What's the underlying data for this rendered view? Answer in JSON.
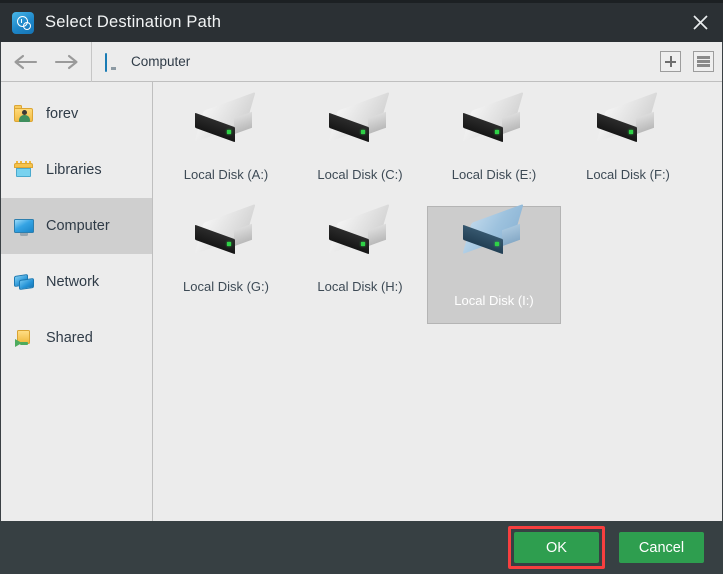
{
  "window": {
    "title": "Select Destination Path",
    "app_icon": "clock-gear-icon",
    "close_icon": "close-icon"
  },
  "toolbar": {
    "back_icon": "arrow-left-icon",
    "forward_icon": "arrow-right-icon",
    "breadcrumb_icon": "computer-monitor-icon",
    "breadcrumb_label": "Computer",
    "new_folder_icon": "plus-icon",
    "view_list_icon": "list-view-icon"
  },
  "sidebar": {
    "items": [
      {
        "label": "forev",
        "icon": "user-folder-icon",
        "selected": false
      },
      {
        "label": "Libraries",
        "icon": "libraries-folder-icon",
        "selected": false
      },
      {
        "label": "Computer",
        "icon": "computer-monitor-icon",
        "selected": true
      },
      {
        "label": "Network",
        "icon": "network-icon",
        "selected": false
      },
      {
        "label": "Shared",
        "icon": "shared-folder-icon",
        "selected": false
      }
    ]
  },
  "content": {
    "drives": [
      {
        "label": "Local Disk (A:)",
        "icon": "hard-drive-icon",
        "selected": false
      },
      {
        "label": "Local Disk (C:)",
        "icon": "hard-drive-icon",
        "selected": false
      },
      {
        "label": "Local Disk (E:)",
        "icon": "hard-drive-icon",
        "selected": false
      },
      {
        "label": "Local Disk (F:)",
        "icon": "hard-drive-icon",
        "selected": false
      },
      {
        "label": "Local Disk (G:)",
        "icon": "hard-drive-icon",
        "selected": false
      },
      {
        "label": "Local Disk (H:)",
        "icon": "hard-drive-icon",
        "selected": false
      },
      {
        "label": "Local Disk (I:)",
        "icon": "hard-drive-icon",
        "selected": true
      }
    ]
  },
  "footer": {
    "ok_label": "OK",
    "cancel_label": "Cancel"
  },
  "colors": {
    "titlebar": "#2b3034",
    "footer": "#374043",
    "content_bg": "#ececec",
    "button_green": "#2e9e4f",
    "highlight_red": "#f73f3f",
    "selection_gray": "#cccccc",
    "accent_blue": "#2196dd"
  }
}
